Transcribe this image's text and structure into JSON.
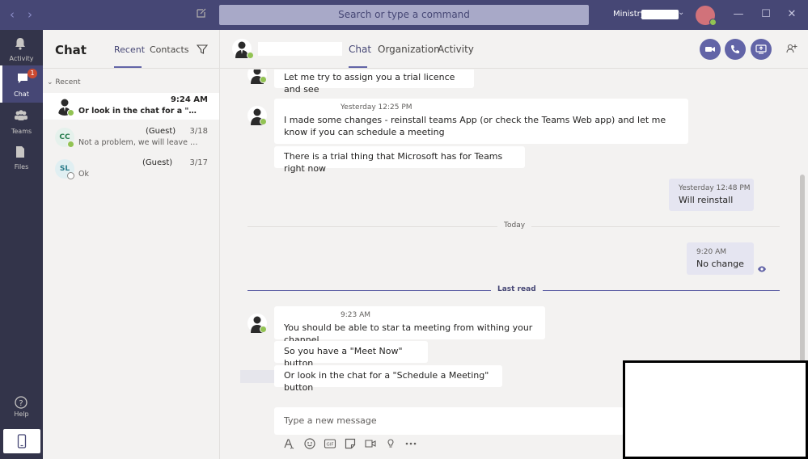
{
  "titlebar": {
    "search_placeholder": "Search or type a command",
    "tenant": "Ministry"
  },
  "rail": {
    "items": [
      {
        "label": "Activity",
        "icon": "bell-icon"
      },
      {
        "label": "Chat",
        "icon": "chat-icon",
        "badge": "1",
        "active": true
      },
      {
        "label": "Teams",
        "icon": "teams-icon"
      },
      {
        "label": "Files",
        "icon": "files-icon"
      }
    ],
    "help_label": "Help"
  },
  "chatlist": {
    "title": "Chat",
    "tabs": [
      "Recent",
      "Contacts"
    ],
    "section": "Recent",
    "conversations": [
      {
        "name": "",
        "time": "9:24 AM",
        "preview": "Or look in the chat for a \"Schedule a Meeting\" button",
        "active": true,
        "presence": "available"
      },
      {
        "initials": "CC",
        "name": "(Guest)",
        "time": "3/18",
        "preview": "Not a problem, we will leave it for now",
        "presence": "available"
      },
      {
        "initials": "SL",
        "name": "(Guest)",
        "time": "3/17",
        "preview": "Ok",
        "presence": "offline"
      }
    ]
  },
  "conversation": {
    "tabs": [
      "Chat",
      "Organization",
      "Activity"
    ],
    "messages": [
      {
        "text": "Let me try to assign you a trial licence and see"
      },
      {
        "meta": "Yesterday 12:25 PM",
        "text": "I made some changes - reinstall teams App (or check the Teams Web app) and let me know if you can schedule a meeting"
      },
      {
        "text": "There is a trial thing that Microsoft has for Teams right now"
      },
      {
        "meta": "Yesterday 12:48 PM",
        "text": "Will reinstall",
        "mine": true
      },
      {
        "meta": "9:20 AM",
        "text": "No change",
        "mine": true
      },
      {
        "meta": "9:23 AM",
        "text": "You should be able to star ta meeting from withing your channel"
      },
      {
        "text": "So you have a \"Meet Now\" button"
      },
      {
        "text": "Or look in the chat for a \"Schedule a Meeting\" button"
      }
    ],
    "date_divider": "Today",
    "last_read": "Last read"
  },
  "compose": {
    "placeholder": "Type a new message"
  },
  "colors": {
    "titlebar": "#464775",
    "rail": "#33344a",
    "accent": "#6264a7",
    "presence": "#92c353",
    "badge": "#cc4a31"
  }
}
